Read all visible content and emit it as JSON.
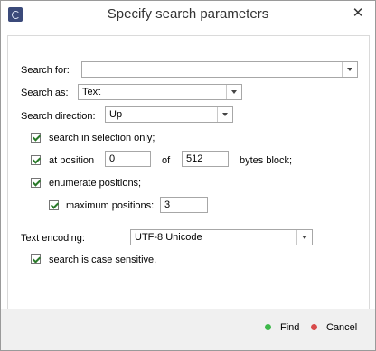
{
  "window": {
    "title": "Specify search parameters"
  },
  "form": {
    "search_for": {
      "label": "Search for:",
      "value": ""
    },
    "search_as": {
      "label": "Search as:",
      "value": "Text"
    },
    "search_direction": {
      "label": "Search direction:",
      "value": "Up"
    },
    "search_in_selection": {
      "label": "search in selection only;",
      "checked": true
    },
    "at_position": {
      "label": "at position",
      "checked": true,
      "start": "0",
      "of_label": "of",
      "block_size": "512",
      "suffix": "bytes block;"
    },
    "enumerate_positions": {
      "label": "enumerate positions;",
      "checked": true
    },
    "maximum_positions": {
      "label": "maximum positions:",
      "checked": true,
      "value": "3"
    },
    "text_encoding": {
      "label": "Text encoding:",
      "value": "UTF-8 Unicode"
    },
    "case_sensitive": {
      "label": "search is case sensitive.",
      "checked": true
    }
  },
  "footer": {
    "find_label": "Find",
    "find_color": "#3db84a",
    "cancel_label": "Cancel",
    "cancel_color": "#d84b4b"
  }
}
